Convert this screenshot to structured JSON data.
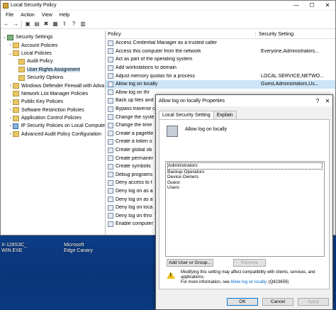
{
  "window": {
    "title": "Local Security Policy",
    "controls": {
      "minimize": "—",
      "maximize": "☐",
      "close": "✕"
    }
  },
  "menu": [
    "File",
    "Action",
    "View",
    "Help"
  ],
  "toolbar": [
    "←",
    "→",
    "▣",
    "▤",
    "✖",
    "▦",
    "⇪",
    "?",
    "▥"
  ],
  "tree": [
    {
      "label": "Security Settings",
      "level": 0,
      "twist": "⌄",
      "icon": "shield-icon"
    },
    {
      "label": "Account Policies",
      "level": 1,
      "twist": "›",
      "icon": "folder-icon"
    },
    {
      "label": "Local Policies",
      "level": 1,
      "twist": "⌄",
      "icon": "folder-icon"
    },
    {
      "label": "Audit Policy",
      "level": 2,
      "twist": "",
      "icon": "folder-icon"
    },
    {
      "label": "User Rights Assignment",
      "level": 2,
      "twist": "",
      "icon": "folder-icon",
      "selected": true
    },
    {
      "label": "Security Options",
      "level": 2,
      "twist": "",
      "icon": "folder-icon"
    },
    {
      "label": "Windows Defender Firewall with Adva",
      "level": 1,
      "twist": "›",
      "icon": "folder-icon"
    },
    {
      "label": "Network List Manager Policies",
      "level": 1,
      "twist": "",
      "icon": "folder-icon"
    },
    {
      "label": "Public Key Policies",
      "level": 1,
      "twist": "›",
      "icon": "folder-icon"
    },
    {
      "label": "Software Restriction Policies",
      "level": 1,
      "twist": "›",
      "icon": "folder-icon"
    },
    {
      "label": "Application Control Policies",
      "level": 1,
      "twist": "›",
      "icon": "folder-icon"
    },
    {
      "label": "IP Security Policies on Local Compute",
      "level": 1,
      "twist": "›",
      "icon": "comp-icon"
    },
    {
      "label": "Advanced Audit Policy Configuration",
      "level": 1,
      "twist": "›",
      "icon": "folder-icon"
    }
  ],
  "list": {
    "headers": {
      "policy": "Policy",
      "setting": "Security Setting"
    },
    "rows": [
      {
        "policy": "Access Credential Manager as a trusted caller",
        "setting": ""
      },
      {
        "policy": "Access this computer from the network",
        "setting": "Everyone,Administrators..."
      },
      {
        "policy": "Act as part of the operating system",
        "setting": ""
      },
      {
        "policy": "Add workstations to domain",
        "setting": ""
      },
      {
        "policy": "Adjust memory quotas for a process",
        "setting": "LOCAL SERVICE,NETWO..."
      },
      {
        "policy": "Allow log on locally",
        "setting": "Guest,Administrators,Us...",
        "selected": true
      },
      {
        "policy": "Allow log on thr",
        "setting": ""
      },
      {
        "policy": "Back up files and",
        "setting": ""
      },
      {
        "policy": "Bypass traverse c",
        "setting": ""
      },
      {
        "policy": "Change the syste",
        "setting": ""
      },
      {
        "policy": "Change the time",
        "setting": ""
      },
      {
        "policy": "Create a pagefile",
        "setting": ""
      },
      {
        "policy": "Create a token o",
        "setting": ""
      },
      {
        "policy": "Create global ob",
        "setting": ""
      },
      {
        "policy": "Create permaner",
        "setting": ""
      },
      {
        "policy": "Create symbolic",
        "setting": ""
      },
      {
        "policy": "Debug programs",
        "setting": ""
      },
      {
        "policy": "Deny access to t",
        "setting": ""
      },
      {
        "policy": "Deny log on as a",
        "setting": ""
      },
      {
        "policy": "Deny log on as a",
        "setting": ""
      },
      {
        "policy": "Deny log on loca",
        "setting": ""
      },
      {
        "policy": "Deny log on thro",
        "setting": ""
      },
      {
        "policy": "Enable computer",
        "setting": ""
      }
    ]
  },
  "desktop": [
    {
      "label": "X-128S3C_\nWIN.EXE"
    },
    {
      "label": "Microsoft\nEdge Canary"
    }
  ],
  "dialog": {
    "title": "Allow log on locally Properties",
    "help": "?",
    "close": "✕",
    "tabs": [
      "Local Security Setting",
      "Explain"
    ],
    "policy_name": "Allow log on locally",
    "users": [
      "Administrators",
      "Backup Operators",
      "Device Owners",
      "Guest",
      "Users"
    ],
    "add_button": "Add User or Group...",
    "remove_button": "Remove",
    "warning_line1": "Modifying this setting may affect compatibility with clients, services, and applications.",
    "warning_prefix": "For more information, see ",
    "warning_link": "Allow log on locally",
    "warning_suffix": ". (Q823659)",
    "ok": "OK",
    "cancel": "Cancel",
    "apply": "Apply"
  }
}
